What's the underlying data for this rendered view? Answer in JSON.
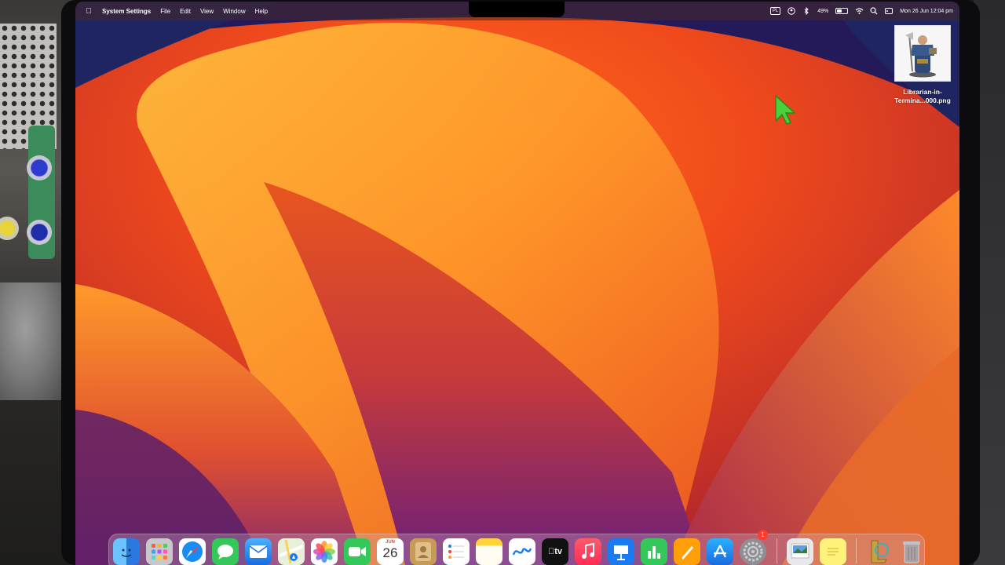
{
  "menubar": {
    "app_name": "System Settings",
    "menus": [
      "File",
      "Edit",
      "View",
      "Window",
      "Help"
    ],
    "input_source": "PL",
    "battery_percent": "49%",
    "battery_level": 0.49,
    "datetime": "Mon 26 Jun  12:04 pm"
  },
  "desktop": {
    "file_name_line1": "Librarian-in-",
    "file_name_line2": "Termina...000.png"
  },
  "dock": {
    "calendar_month": "JUN",
    "calendar_day": "26",
    "tv_label": "tv",
    "system_settings_badge": "1",
    "icons": [
      "finder-icon",
      "launchpad-icon",
      "safari-icon",
      "messages-icon",
      "mail-icon",
      "maps-icon",
      "photos-icon",
      "facetime-icon",
      "calendar-icon",
      "contacts-icon",
      "reminders-icon",
      "notes-icon",
      "freeform-icon",
      "tv-icon",
      "music-icon",
      "keynote-icon",
      "numbers-icon",
      "pages-icon",
      "app-store-icon",
      "system-settings-icon",
      "preview-icon",
      "stickies-icon",
      "league-icon",
      "trash-icon"
    ]
  },
  "colors": {
    "wallpaper_orange": "#f06a1e",
    "wallpaper_yellow": "#ffb13a",
    "wallpaper_purple": "#6a1f7a",
    "wallpaper_navy": "#1e2460",
    "cursor_green": "#4cd13a"
  }
}
